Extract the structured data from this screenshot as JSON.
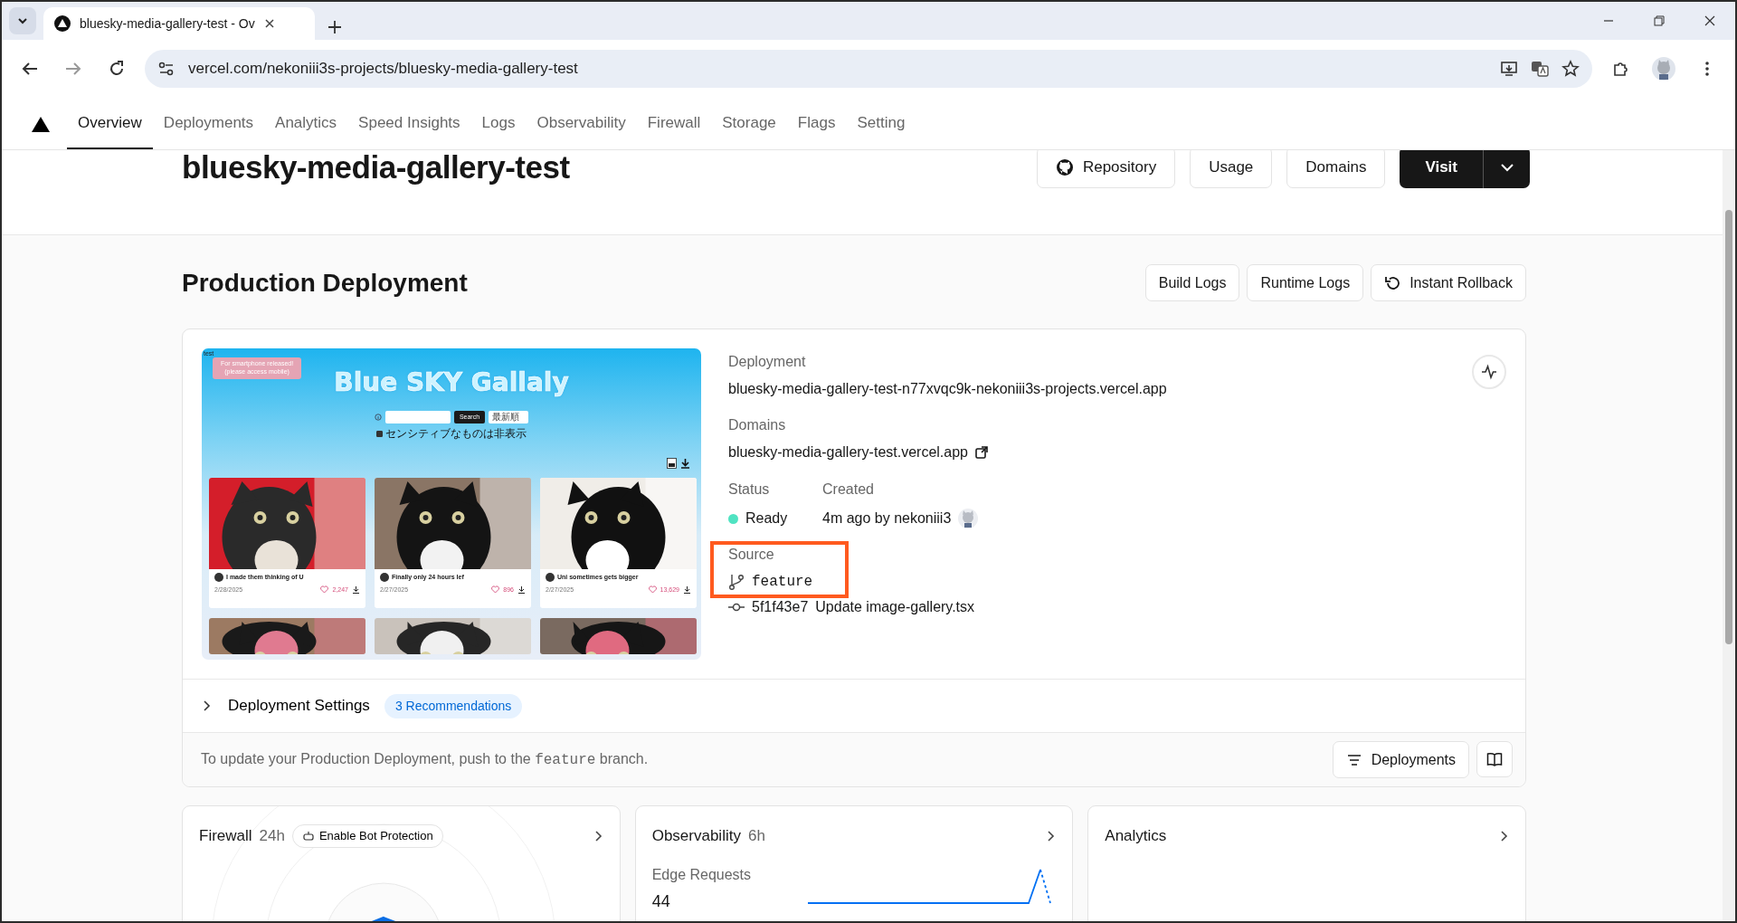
{
  "browser": {
    "tab_title": "bluesky-media-gallery-test - Ov",
    "url": "vercel.com/nekoniii3s-projects/bluesky-media-gallery-test"
  },
  "nav": [
    {
      "label": "Overview",
      "selected": true
    },
    {
      "label": "Deployments",
      "selected": false
    },
    {
      "label": "Analytics",
      "selected": false
    },
    {
      "label": "Speed Insights",
      "selected": false
    },
    {
      "label": "Logs",
      "selected": false
    },
    {
      "label": "Observability",
      "selected": false
    },
    {
      "label": "Firewall",
      "selected": false
    },
    {
      "label": "Storage",
      "selected": false
    },
    {
      "label": "Flags",
      "selected": false
    },
    {
      "label": "Setting",
      "selected": false
    }
  ],
  "project": {
    "title": "bluesky-media-gallery-test",
    "buttons": [
      {
        "label": "Repository",
        "kind": "github"
      },
      {
        "label": "Usage",
        "kind": "plain"
      },
      {
        "label": "Domains",
        "kind": "plain"
      }
    ],
    "visit": "Visit"
  },
  "production": {
    "heading": "Production Deployment",
    "buttons": [
      {
        "label": "Build Logs",
        "kind": "plain"
      },
      {
        "label": "Runtime Logs",
        "kind": "plain"
      },
      {
        "label": "Instant Rollback",
        "kind": "rollback"
      }
    ]
  },
  "preview": {
    "corner_text": "test",
    "notice": [
      "For smartphone released!",
      "(please access mobile)"
    ],
    "title": "Blue SKY Gallaly",
    "search_button": "Search",
    "sort": "最新順",
    "sensitive_label": "センシティブなものは非表示",
    "sensitive_checked": true,
    "cards": [
      {
        "title": "I made them thinking of U",
        "date": "2/28/2025",
        "likes": "2,247"
      },
      {
        "title": "Finally only 24 hours lef",
        "date": "2/27/2025",
        "likes": "896"
      },
      {
        "title": "Uni sometimes gets bigger",
        "date": "2/27/2025",
        "likes": "13,629"
      }
    ]
  },
  "deployment": {
    "label": "Deployment",
    "url": "bluesky-media-gallery-test-n77xvqc9k-nekoniii3s-projects.vercel.app",
    "domains_label": "Domains",
    "domain": "bluesky-media-gallery-test.vercel.app",
    "status_label": "Status",
    "status": "Ready",
    "created_label": "Created",
    "created": "4m ago by nekoniii3",
    "source_label": "Source",
    "branch": "feature",
    "commit_hash": "5f1f43e7",
    "commit_message": "Update image-gallery.tsx"
  },
  "settings": {
    "label": "Deployment Settings",
    "badge": "3 Recommendations",
    "expanded": false
  },
  "note": {
    "before": "To update your Production Deployment, push to the",
    "branch": "feature",
    "after": "branch."
  },
  "footer_button": "Deployments",
  "panels": [
    {
      "title": "Firewall",
      "period": "24h",
      "badge": "Enable Bot Protection"
    },
    {
      "title": "Observability",
      "period": "6h",
      "metric_label": "Edge Requests",
      "metric_value": "44"
    },
    {
      "title": "Analytics"
    }
  ]
}
